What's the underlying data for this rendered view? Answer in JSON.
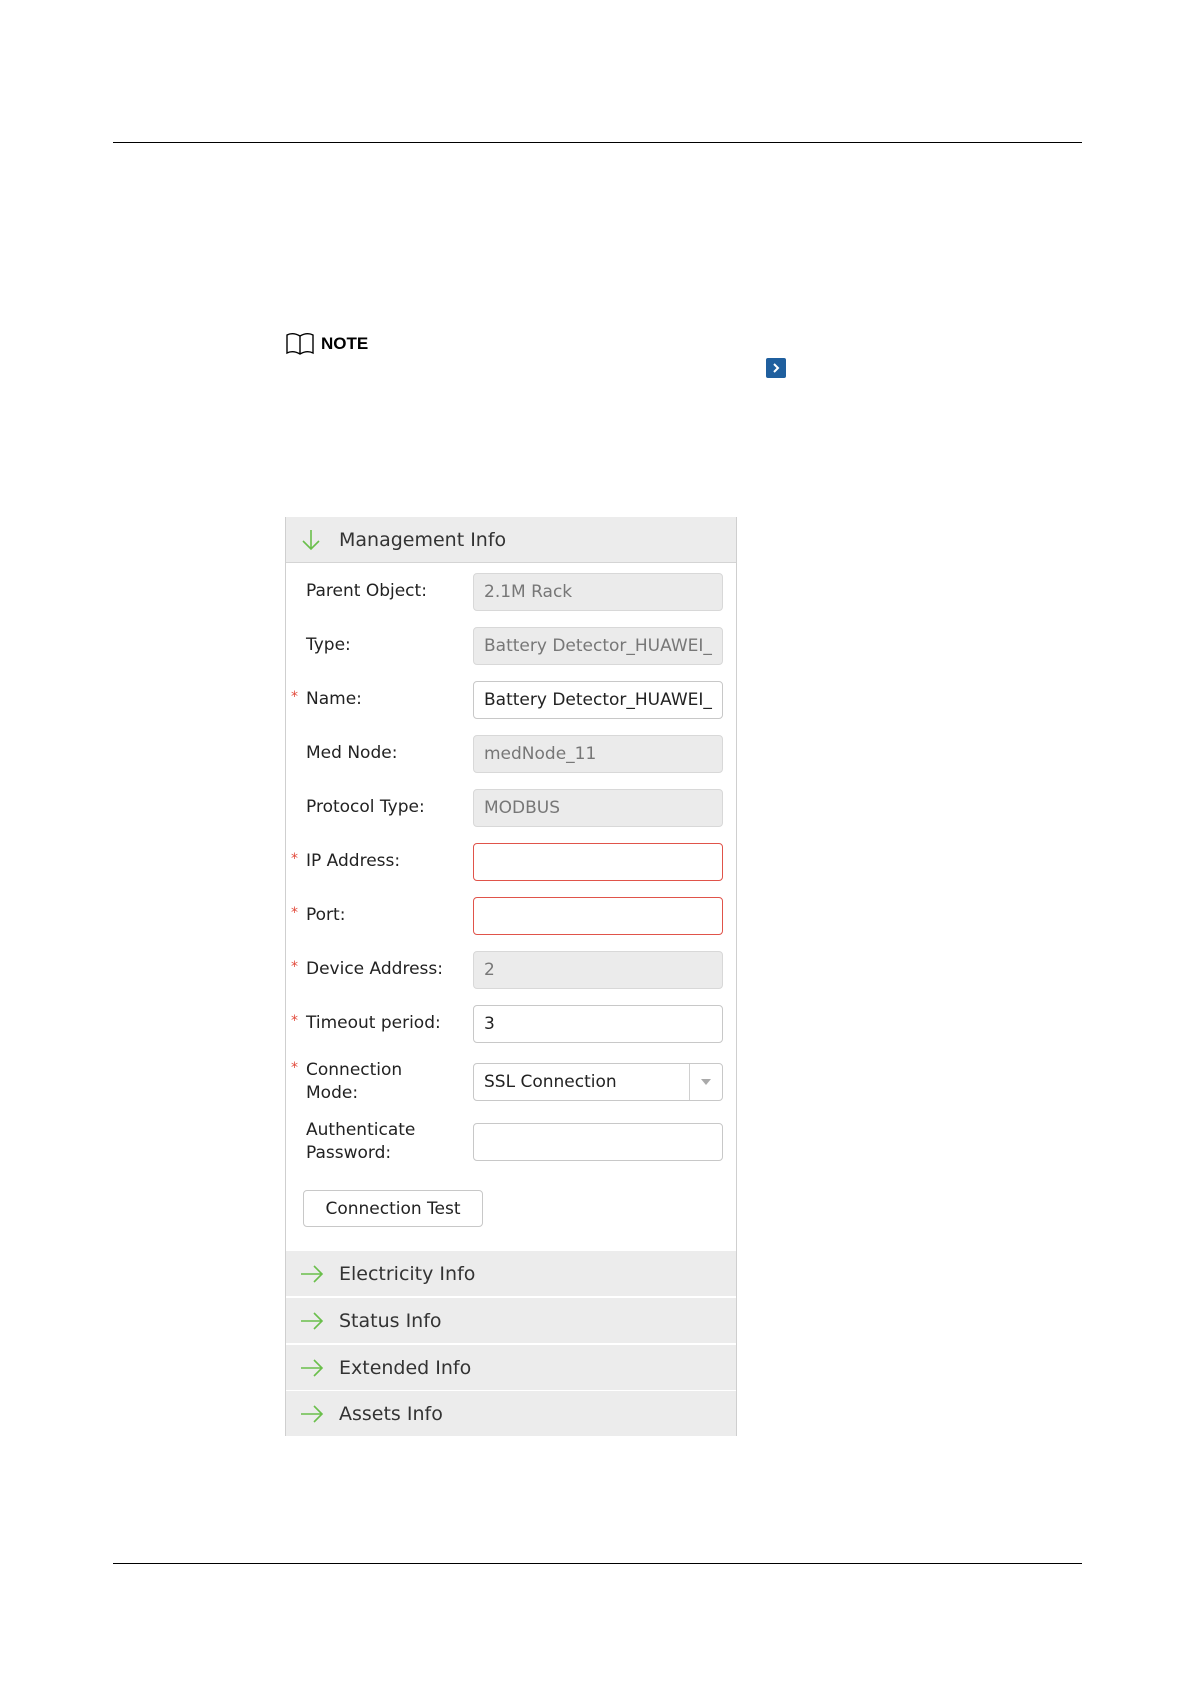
{
  "note": {
    "label": "NOTE"
  },
  "panel": {
    "management": {
      "title": "Management Info",
      "fields": [
        {
          "label": "Parent Object:",
          "value": "2.1M Rack",
          "required": false,
          "readonly": true
        },
        {
          "label": "Type:",
          "value": "Battery Detector_HUAWEI_",
          "required": false,
          "readonly": true
        },
        {
          "label": "Name:",
          "value": "Battery Detector_HUAWEI_",
          "required": true,
          "readonly": false
        },
        {
          "label": "Med Node:",
          "value": "medNode_11",
          "required": false,
          "readonly": true
        },
        {
          "label": "Protocol Type:",
          "value": "MODBUS",
          "required": false,
          "readonly": true
        },
        {
          "label": "IP Address:",
          "value": "",
          "required": true,
          "readonly": false,
          "error": true
        },
        {
          "label": "Port:",
          "value": "",
          "required": true,
          "readonly": false,
          "error": true
        },
        {
          "label": "Device Address:",
          "value": "2",
          "required": true,
          "readonly": true
        },
        {
          "label": "Timeout period:",
          "value": "3",
          "required": true,
          "readonly": false
        },
        {
          "label_line1": "Connection",
          "label_line2": "Mode:",
          "value": "SSL Connection",
          "required": true,
          "type": "select"
        },
        {
          "label_line1": "Authenticate",
          "label_line2": "Password:",
          "value": "",
          "required": false,
          "type": "password"
        }
      ],
      "required_marker": "*",
      "connection_test_label": "Connection Test"
    },
    "sections": [
      {
        "title": "Electricity Info"
      },
      {
        "title": "Status Info"
      },
      {
        "title": "Extended Info"
      },
      {
        "title": "Assets Info"
      }
    ]
  },
  "colors": {
    "error_border": "#e0534a",
    "required_marker": "#e24a3b",
    "expand_arrow": "#6abf4b",
    "nav_chevron": "#1f5f9e"
  }
}
